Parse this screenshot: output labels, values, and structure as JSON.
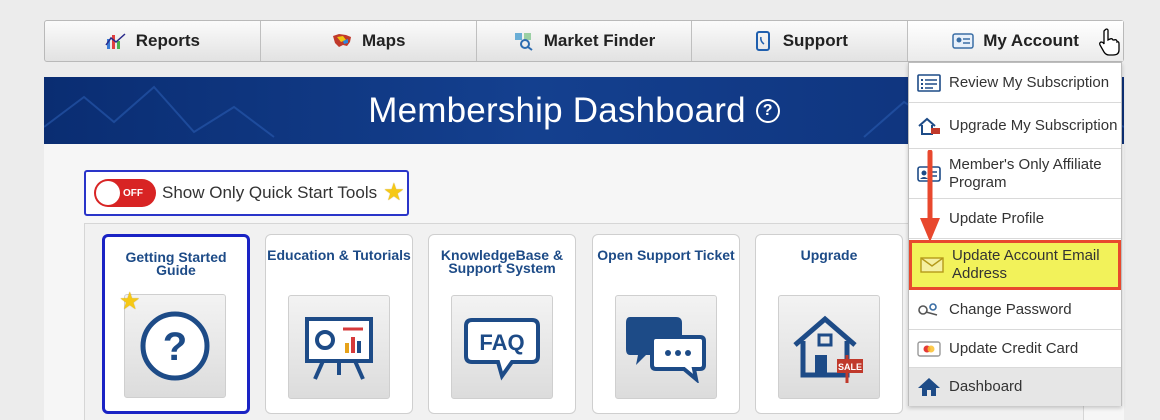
{
  "nav": {
    "items": [
      {
        "label": "Reports",
        "icon": "reports-chart-icon"
      },
      {
        "label": "Maps",
        "icon": "usa-map-icon"
      },
      {
        "label": "Market Finder",
        "icon": "market-finder-icon"
      },
      {
        "label": "Support",
        "icon": "phone-icon"
      },
      {
        "label": "My Account",
        "icon": "account-card-icon"
      }
    ]
  },
  "dashboard": {
    "title": "Membership Dashboard",
    "help_glyph": "?",
    "toggle": {
      "state": "OFF",
      "label": "Show Only Quick Start Tools"
    },
    "tools": [
      {
        "title": "Getting Started Guide",
        "icon": "question-mark-icon",
        "selected": true
      },
      {
        "title": "Education & Tutorials",
        "icon": "presentation-board-icon"
      },
      {
        "title": "KnowledgeBase & Support System",
        "icon": "faq-bubble-icon",
        "center_text": "FAQ"
      },
      {
        "title": "Open Support Ticket",
        "icon": "chat-bubbles-icon"
      },
      {
        "title": "Upgrade",
        "icon": "house-sale-icon",
        "badge_text": "SALE"
      }
    ]
  },
  "account_menu": {
    "items": [
      {
        "label": "Review My Subscription",
        "icon": "subscription-list-icon"
      },
      {
        "label": "Upgrade My Subscription",
        "icon": "house-upgrade-icon"
      },
      {
        "label": "Member's Only Affiliate Program",
        "icon": "affiliate-card-icon"
      },
      {
        "label": "Update Profile",
        "icon": "profile-icon"
      },
      {
        "label": "Update Account Email Address",
        "icon": "envelope-icon",
        "highlighted": true
      },
      {
        "label": "Change Password",
        "icon": "password-keys-icon"
      },
      {
        "label": "Update Credit Card",
        "icon": "credit-card-icon"
      },
      {
        "label": "Dashboard",
        "icon": "home-icon"
      }
    ]
  },
  "colors": {
    "banner": "#14408f",
    "title_text": "#1d4b87",
    "selected_border": "#1a23c4",
    "highlight_bg": "#f2f25a",
    "highlight_border": "#e8482e",
    "toggle_off": "#d82424",
    "arrow": "#e8482e"
  }
}
